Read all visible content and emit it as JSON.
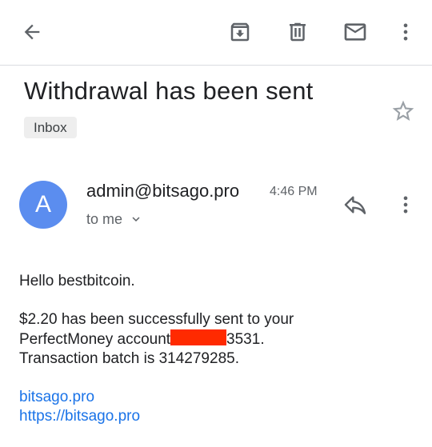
{
  "toolbar": {
    "back_icon": "arrow-back-icon",
    "archive_icon": "archive-icon",
    "delete_icon": "trash-icon",
    "mark_unread_icon": "mail-icon",
    "more_icon": "more-vert-icon"
  },
  "email": {
    "subject": "Withdrawal has been sent",
    "label": "Inbox",
    "star_icon": "star-outline-icon",
    "sender": {
      "avatar_letter": "A",
      "avatar_color": "#5b8def",
      "address": "admin@bitsago.pro",
      "time": "4:46 PM",
      "recipient": "to me"
    },
    "body": {
      "greeting": "Hello bestbitcoin.",
      "line1": "$2.20 has been successfully sent to your",
      "line2_prefix": "PerfectMoney account",
      "line2_suffix": "3531.",
      "line3": "Transaction batch is 314279285.",
      "link1": "bitsago.pro",
      "link2": "https://bitsago.pro"
    }
  },
  "colors": {
    "link": "#1a73e8",
    "icon": "#5f6368",
    "redaction": "#ff2a00"
  }
}
